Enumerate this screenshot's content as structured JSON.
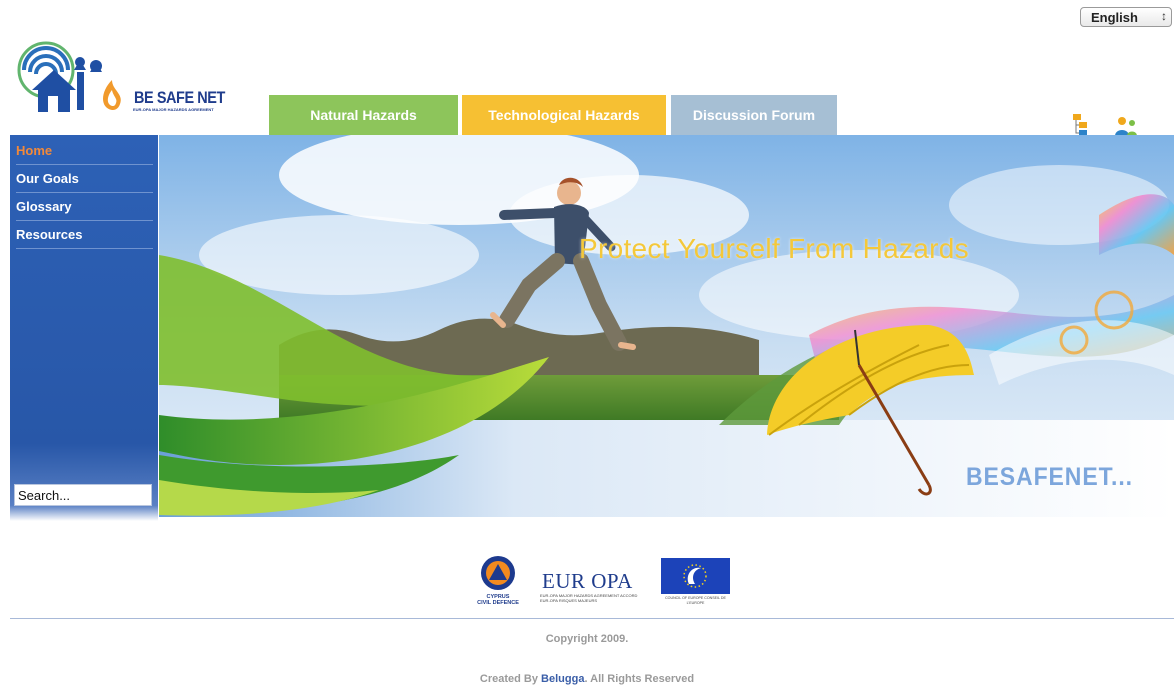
{
  "language_select": {
    "value": "English"
  },
  "logo": {
    "name": "BE SAFE NET",
    "tagline": "EUR-OPA MAJOR HAZARDS AGREEMENT"
  },
  "tabs": [
    {
      "label": "Natural Hazards"
    },
    {
      "label": "Technological Hazards"
    },
    {
      "label": "Discussion Forum"
    }
  ],
  "header_icons": [
    "sitemap-icon",
    "users-icon"
  ],
  "sidebar": {
    "items": [
      {
        "label": "Home",
        "active": true
      },
      {
        "label": "Our Goals"
      },
      {
        "label": "Glossary"
      },
      {
        "label": "Resources"
      }
    ],
    "search": {
      "value": "Search..."
    }
  },
  "banner": {
    "tagline": "Protect Yourself From Hazards",
    "brand_text": "BESAFENET..."
  },
  "partners": {
    "cyprus": {
      "line1": "CYPRUS",
      "line2": "CIVIL DEFENCE"
    },
    "europa": {
      "word": "EUR OPA",
      "sub": "EUR-OPA MAJOR HAZARDS AGREEMENT ACCORD EUR-OPA RISQUES MAJEURS"
    },
    "council": {
      "sub": "COUNCIL OF EUROPE   CONSEIL DE L'EUROPE"
    }
  },
  "footer": {
    "copyright": "Copyright 2009.",
    "created_by_prefix": "Created By ",
    "created_by_link": "Belugga",
    "created_by_suffix": ". All Rights Reserved"
  },
  "colors": {
    "sidebar_blue": "#2d61b6",
    "active_orange": "#f2893a",
    "tab_green": "#8dc55b",
    "tab_yellow": "#f6c033",
    "tab_blue": "#a6bfd4",
    "tagline_yellow": "#f4c83a"
  }
}
